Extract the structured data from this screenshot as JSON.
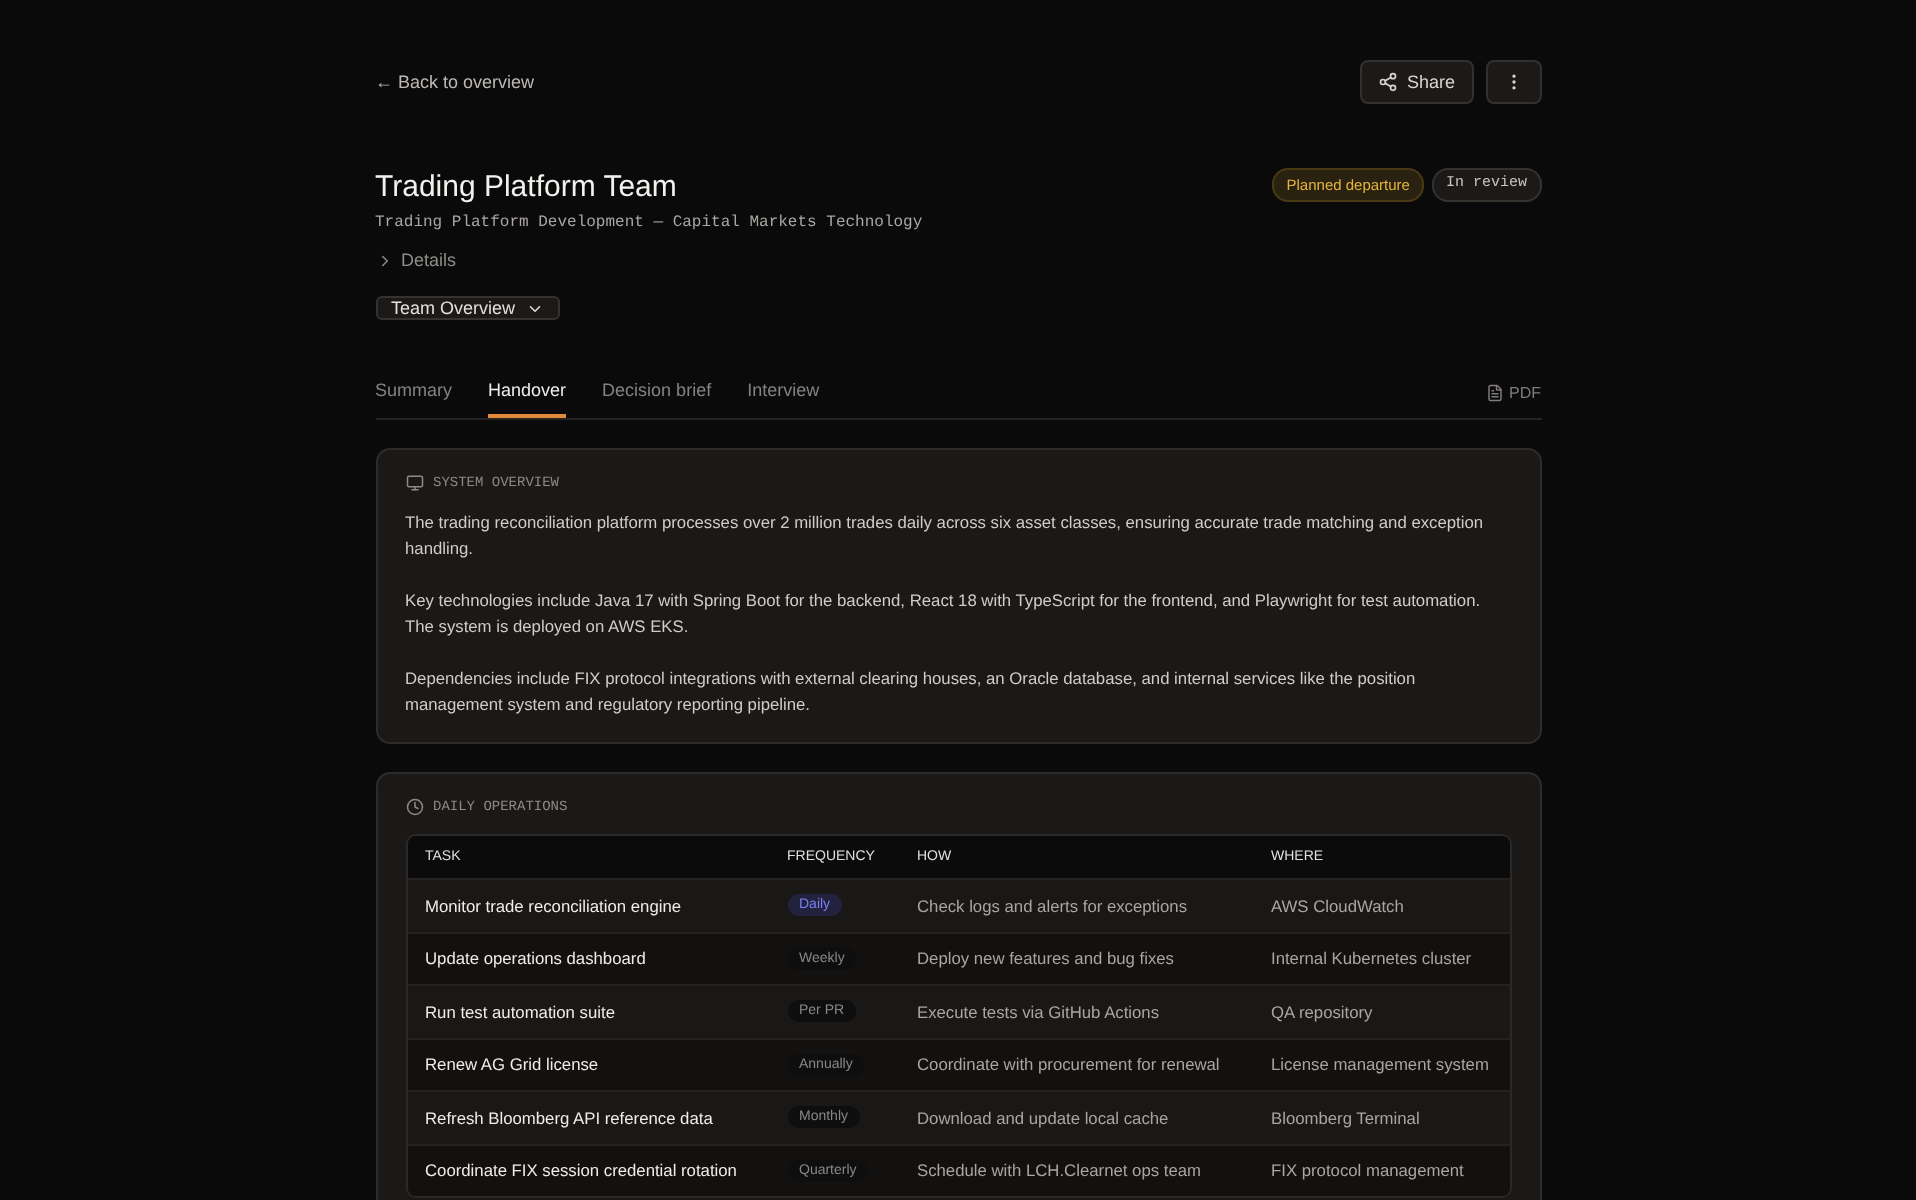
{
  "back_link": "← Back to overview",
  "actions": {
    "share": "Share"
  },
  "header": {
    "title": "Trading Platform Team",
    "subtitle": "Trading Platform Development — Capital Markets Technology",
    "badges": [
      {
        "label": "Planned departure",
        "kind": "warning"
      },
      {
        "label": "In review",
        "kind": "neutral"
      }
    ]
  },
  "details": {
    "label": "Details",
    "expanded": false
  },
  "view_select": {
    "value": "Team Overview"
  },
  "tabs": [
    {
      "label": "Summary",
      "selected": false
    },
    {
      "label": "Handover",
      "selected": true
    },
    {
      "label": "Decision brief",
      "selected": false
    },
    {
      "label": "Interview",
      "selected": false
    }
  ],
  "export": {
    "label": "PDF"
  },
  "system_overview": {
    "heading": "SYSTEM OVERVIEW",
    "paragraphs": [
      "The trading reconciliation platform processes over 2 million trades daily across six asset classes, ensuring accurate trade matching and exception handling.",
      "Key technologies include Java 17 with Spring Boot for the backend, React 18 with TypeScript for the frontend, and Playwright for test automation. The system is deployed on AWS EKS.",
      "Dependencies include FIX protocol integrations with external clearing houses, an Oracle database, and internal services like the position management system and regulatory reporting pipeline."
    ]
  },
  "daily_operations": {
    "heading": "DAILY OPERATIONS",
    "columns": [
      "TASK",
      "FREQUENCY",
      "HOW",
      "WHERE"
    ],
    "rows": [
      {
        "task": "Monitor trade reconciliation engine",
        "frequency": "Daily",
        "color": "#22223e",
        "how": "Check logs and alerts for exceptions",
        "where": "AWS CloudWatch"
      },
      {
        "task": "Update operations dashboard",
        "frequency": "Weekly",
        "color": "#0f0e0e",
        "how": "Deploy new features and bug fixes",
        "where": "Internal Kubernetes cluster"
      },
      {
        "task": "Run test automation suite",
        "frequency": "Per PR",
        "color": "#0f0e0e",
        "how": "Execute tests via GitHub Actions",
        "where": "QA repository"
      },
      {
        "task": "Renew AG Grid license",
        "frequency": "Annually",
        "color": "#0f0e0e",
        "how": "Coordinate with procurement for renewal",
        "where": "License management system"
      },
      {
        "task": "Refresh Bloomberg API reference data",
        "frequency": "Monthly",
        "color": "#0f0e0e",
        "how": "Download and update local cache",
        "where": "Bloomberg Terminal"
      },
      {
        "task": "Coordinate FIX session credential rotation",
        "frequency": "Quarterly",
        "color": "#0f0e0e",
        "how": "Schedule with LCH.Clearnet ops team",
        "where": "FIX protocol management"
      }
    ]
  }
}
